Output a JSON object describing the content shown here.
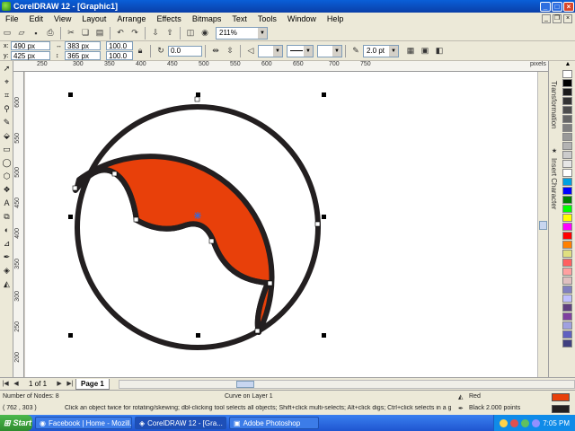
{
  "window": {
    "title": "CorelDRAW 12 - [Graphic1]"
  },
  "menu": [
    "File",
    "Edit",
    "View",
    "Layout",
    "Arrange",
    "Effects",
    "Bitmaps",
    "Text",
    "Tools",
    "Window",
    "Help"
  ],
  "toolbar": {
    "zoom": "211%",
    "x": "490 px",
    "y": "425 px",
    "width": "383 px",
    "height": "365 px",
    "scale_w": "100.0",
    "scale_h": "100.0",
    "angle": "0.0",
    "outline_width": "2.0 pt"
  },
  "rulers": {
    "h_ticks": [
      "250",
      "300",
      "350",
      "400",
      "450",
      "500",
      "550",
      "600",
      "650",
      "700",
      "750"
    ],
    "h_unit": "pixels",
    "v_ticks": [
      "600",
      "550",
      "500",
      "450",
      "400",
      "350",
      "300",
      "250",
      "200"
    ],
    "v_unit": "pixels"
  },
  "dockers": [
    "Transformation",
    "Insert Character"
  ],
  "palette": [
    "#ffffff",
    "#000000",
    "#1a1a1a",
    "#333333",
    "#4d4d4d",
    "#666666",
    "#808080",
    "#999999",
    "#b3b3b3",
    "#cccccc",
    "#e6e6e6",
    "#ffffff",
    "#00a0e0",
    "#0000ff",
    "#008000",
    "#00ff00",
    "#ffff00",
    "#ff00ff",
    "#ff0000",
    "#ff8000",
    "#e0e080",
    "#ff6060",
    "#ffa0a0",
    "#e0c0c0",
    "#8080c0",
    "#c0c0ff",
    "#604080",
    "#8040a0",
    "#a0a0e0",
    "#6060c0",
    "#404080"
  ],
  "page_nav": {
    "count": "1 of 1",
    "tab": "Page 1"
  },
  "status": {
    "nodes": "Number of Nodes: 8",
    "object": "Curve on Layer 1",
    "fill_label": "Red",
    "fill_color": "#e8400a",
    "outline_label": "Black  2.000 points",
    "outline_color": "#231f20",
    "coords": "( 762 , 303 )",
    "hint": "Click an object twice for rotating/skewing; dbl-clicking tool selects all objects; Shift+click multi-selects; Alt+click digs; Ctrl+click selects in a group"
  },
  "taskbar": {
    "start": "Start",
    "tasks": [
      "Facebook | Home - Mozill...",
      "CorelDRAW 12 - [Gra...",
      "Adobe Photoshop"
    ],
    "time": "7:05 PM"
  },
  "drawing": {
    "fill": "#e8400a",
    "stroke": "#231f20"
  }
}
